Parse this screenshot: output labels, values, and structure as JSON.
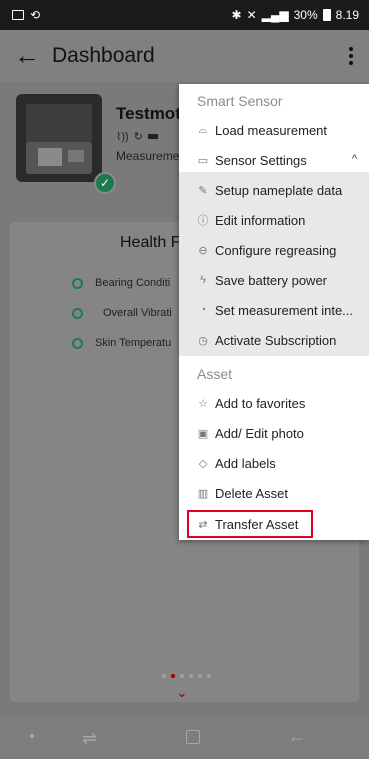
{
  "status_bar": {
    "battery_text": "30%",
    "time": "8.19"
  },
  "app_bar": {
    "title": "Dashboard"
  },
  "asset": {
    "name": "Testmot",
    "measurement_label": "Measureme"
  },
  "health": {
    "title": "Health F",
    "items": [
      {
        "label": "Bearing Conditi"
      },
      {
        "label": "Overall Vibrati"
      },
      {
        "label": "Skin Temperatu"
      }
    ]
  },
  "pager": {
    "page_count": 6,
    "active_index": 1
  },
  "menu": {
    "smart_sensor_header": "Smart Sensor",
    "load_measurement": "Load measurement",
    "sensor_settings": "Sensor Settings",
    "sensor_settings_sub": [
      {
        "label": "Setup nameplate data",
        "icon": "edit-icon"
      },
      {
        "label": "Edit information",
        "icon": "info-icon"
      },
      {
        "label": "Configure regreasing",
        "icon": "grease-icon"
      },
      {
        "label": "Save battery power",
        "icon": "bolt-icon"
      },
      {
        "label": "Set measurement inte...",
        "icon": "timer-icon"
      },
      {
        "label": "Activate Subscription",
        "icon": "clock-icon"
      }
    ],
    "asset_header": "Asset",
    "asset_items": [
      {
        "label": "Add to favorites",
        "icon": "star-icon"
      },
      {
        "label": "Add/ Edit photo",
        "icon": "photo-icon"
      },
      {
        "label": "Add labels",
        "icon": "tag-icon"
      },
      {
        "label": "Delete Asset",
        "icon": "trash-icon"
      },
      {
        "label": "Transfer Asset",
        "icon": "transfer-icon"
      }
    ]
  },
  "colors": {
    "accent_green": "#1c7a4f",
    "highlight_red": "#e3001b",
    "pager_active": "#a40000"
  }
}
